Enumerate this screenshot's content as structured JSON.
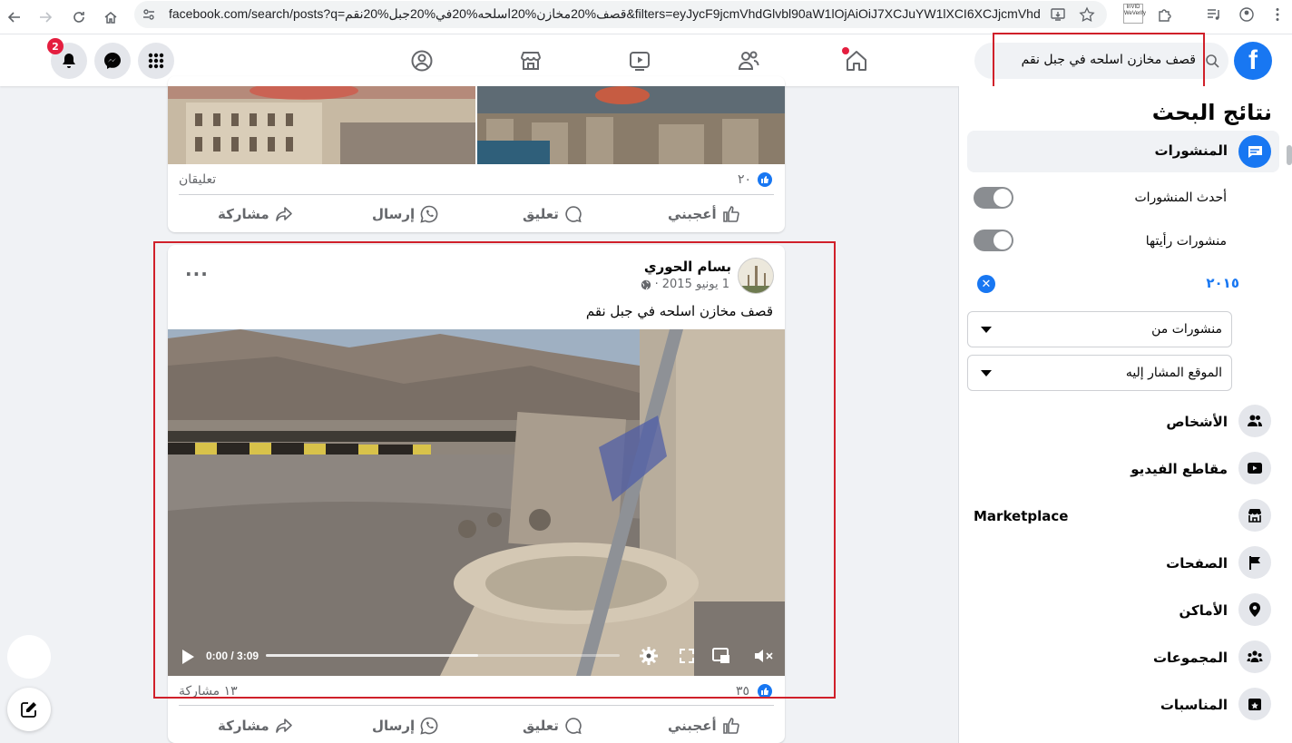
{
  "browser": {
    "url": "facebook.com/search/posts?q=قصف%20مخازن%20اسلحه%20في%20جبل%20نقم&filters=eyJycF9jcmVhdGlvbl90aW1lOjAiOiJ7XCJuYW1lXCI6XCJjcmVhdGlv...",
    "extension_label": "InVID WeVerify"
  },
  "topbar": {
    "notifications_count": "2",
    "search_query": "قصف مخازن اسلحه في جبل نقم",
    "logo_letter": "f"
  },
  "sidebar": {
    "title": "نتائج البحث",
    "active_item": "المنشورات",
    "toggle_recent": "أحدث المنشورات",
    "toggle_seen": "منشورات رأيتها",
    "year_filter": "٢٠١٥",
    "dropdown_posts_from": "منشورات من",
    "dropdown_location": "الموقع المشار إليه",
    "items": [
      {
        "label": "الأشخاص",
        "icon": "people-icon"
      },
      {
        "label": "مقاطع الفيديو",
        "icon": "video-play-icon"
      },
      {
        "label": "Marketplace",
        "icon": "marketplace-icon"
      },
      {
        "label": "الصفحات",
        "icon": "flag-icon"
      },
      {
        "label": "الأماكن",
        "icon": "location-pin-icon"
      },
      {
        "label": "المجموعات",
        "icon": "groups-icon"
      },
      {
        "label": "المناسبات",
        "icon": "calendar-star-icon"
      }
    ]
  },
  "post1": {
    "likes": "٢٠",
    "comments": "تعليقان",
    "actions": {
      "like": "أعجبني",
      "comment": "تعليق",
      "send": "إرسال",
      "share": "مشاركة"
    }
  },
  "post2": {
    "author": "بسام الحوري",
    "date": "1 يونيو 2015",
    "separator": "·",
    "text": "قصف مخازن اسلحه في جبل نقم",
    "video_time": "0:00 / 3:09",
    "video_buffered_fraction": 0.6,
    "likes": "٣٥",
    "shares": "١٣ مشاركة",
    "actions": {
      "like": "أعجبني",
      "comment": "تعليق",
      "send": "إرسال",
      "share": "مشاركة"
    }
  },
  "colors": {
    "fb_blue": "#1877f2",
    "highlight_red": "#d0202a"
  }
}
